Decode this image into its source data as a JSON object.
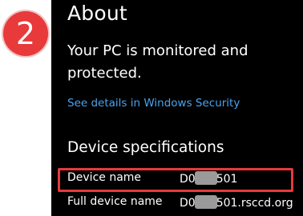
{
  "step_badge": "2",
  "page": {
    "title": "About",
    "status_text": "Your PC is monitored and protected.",
    "security_link": "See details in Windows Security"
  },
  "device_specs": {
    "heading": "Device specifications",
    "rows": [
      {
        "label": "Device name",
        "value_prefix": "D0",
        "value_suffix": "501"
      },
      {
        "label": "Full device name",
        "value_prefix": "D0",
        "value_suffix": "501.rsccd.org"
      }
    ]
  },
  "colors": {
    "panel_bg": "#000000",
    "text": "#ffffff",
    "link": "#4aa3ef",
    "annotation_red": "#e8393b",
    "redaction": "#9a9a9a"
  }
}
